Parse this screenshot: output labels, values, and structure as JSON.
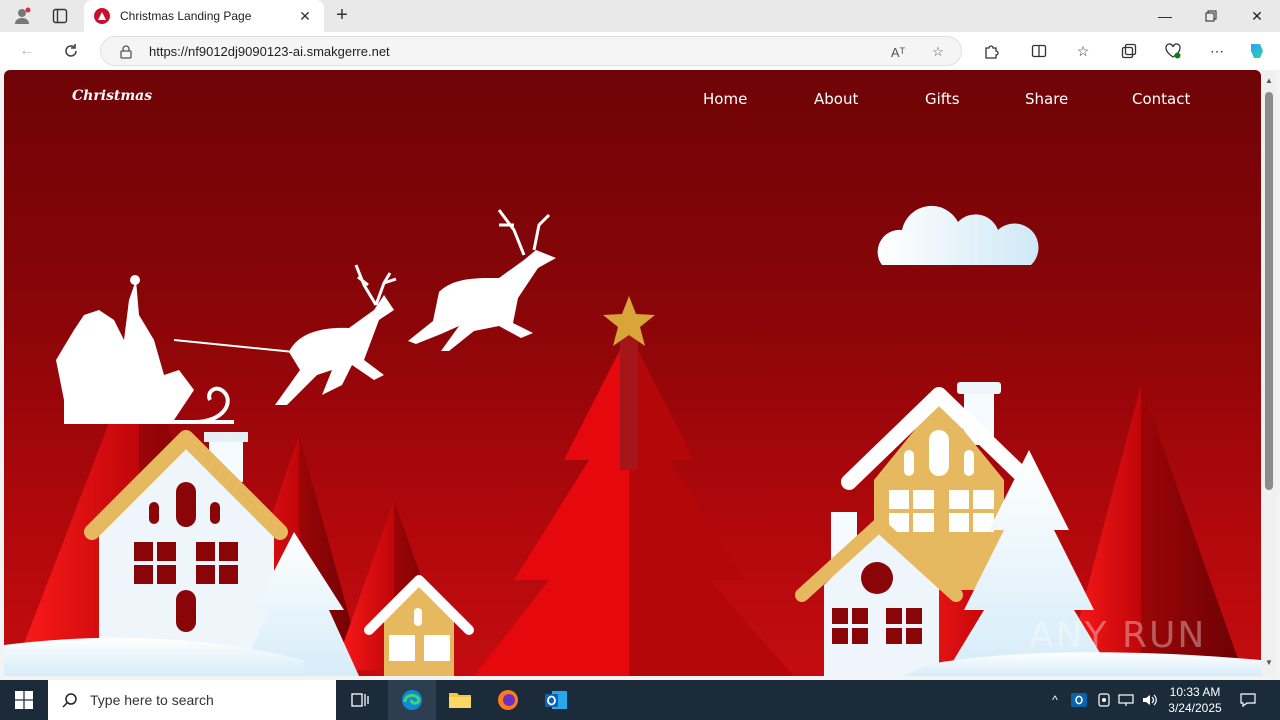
{
  "browser": {
    "tab_title": "Christmas Landing Page",
    "new_tab_symbol": "+",
    "url": "https://nf9012dj9090123-ai.smakgerre.net",
    "read_aloud_label": "Aᵀ"
  },
  "page": {
    "logo": "Christmas",
    "nav": [
      "Home",
      "About",
      "Gifts",
      "Share",
      "Contact"
    ],
    "watermark": "ANY RUN"
  },
  "taskbar": {
    "search_placeholder": "Type here to search",
    "time": "10:33 AM",
    "date": "3/24/2025"
  },
  "colors": {
    "background_top": "#6e0406",
    "background_bottom": "#c40c10",
    "accent_red": "#e8080d",
    "house_gold": "#e6b860",
    "star_gold": "#d9a43a",
    "snow_white": "#eef6fc"
  }
}
